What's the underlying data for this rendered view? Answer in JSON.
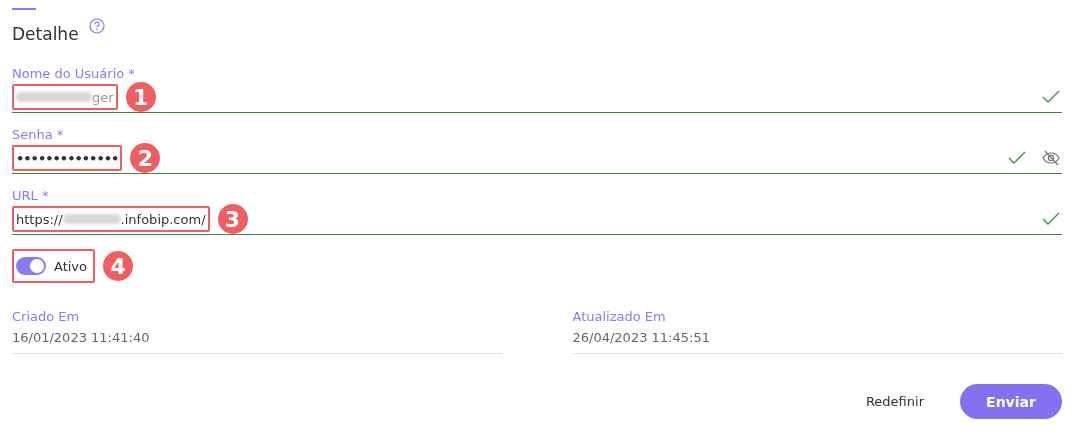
{
  "section": {
    "title": "Detalhe"
  },
  "fields": [
    {
      "kind": "text",
      "label": "Nome do Usuário *",
      "value_suffix": "ger",
      "redacted": true,
      "valid": true,
      "callout": "1"
    },
    {
      "kind": "password",
      "label": "Senha *",
      "value_prefix": "••••••••••••••",
      "redacted": false,
      "valid": true,
      "callout": "2"
    },
    {
      "kind": "url",
      "label": "URL *",
      "value_prefix": "https://",
      "value_suffix": ".infobip.com/",
      "redacted": true,
      "valid": true,
      "callout": "3"
    }
  ],
  "toggle": {
    "label": "Ativo",
    "on": true,
    "callout": "4"
  },
  "meta": [
    {
      "label": "Criado Em",
      "value": "16/01/2023 11:41:40"
    },
    {
      "label": "Atualizado Em",
      "value": "26/04/2023 11:45:51"
    }
  ],
  "buttons": {
    "reset": "Redefinir",
    "submit": "Enviar"
  }
}
